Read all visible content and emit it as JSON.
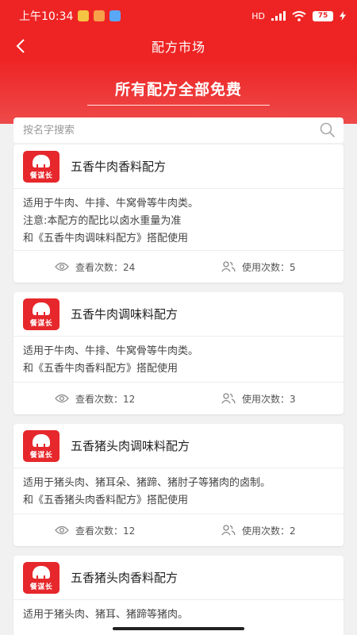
{
  "status_bar": {
    "time": "上午10:34",
    "network_label": "HD",
    "battery_level": "75",
    "accent_color": "#ee2424"
  },
  "nav": {
    "back_icon": "chevron-left-icon",
    "title": "配方市场"
  },
  "hero": {
    "title": "所有配方全部免费"
  },
  "search": {
    "placeholder": "按名字搜索",
    "icon": "search-icon"
  },
  "recipes": [
    {
      "logo_text": "餐谋长",
      "title": "五香牛肉香料配方",
      "lines": [
        "适用于牛肉、牛排、牛窝骨等牛肉类。",
        "注意:本配方的配比以卤水重量为准",
        "和《五香牛肉调味料配方》搭配使用"
      ],
      "views_label": "查看次数：24",
      "uses_label": "使用次数：5"
    },
    {
      "logo_text": "餐谋长",
      "title": "五香牛肉调味料配方",
      "lines": [
        "适用于牛肉、牛排、牛窝骨等牛肉类。",
        "和《五香牛肉香料配方》搭配使用"
      ],
      "views_label": "查看次数：12",
      "uses_label": "使用次数：3"
    },
    {
      "logo_text": "餐谋长",
      "title": "五香猪头肉调味料配方",
      "lines": [
        "适用于猪头肉、猪耳朵、猪蹄、猪肘子等猪肉的卤制。",
        "和《五香猪头肉香料配方》搭配使用"
      ],
      "views_label": "查看次数：12",
      "uses_label": "使用次数：2"
    },
    {
      "logo_text": "餐谋长",
      "title": "五香猪头肉香料配方",
      "lines": [
        "适用于猪头肉、猪耳、猪蹄等猪肉。"
      ],
      "views_label": "",
      "uses_label": ""
    }
  ]
}
